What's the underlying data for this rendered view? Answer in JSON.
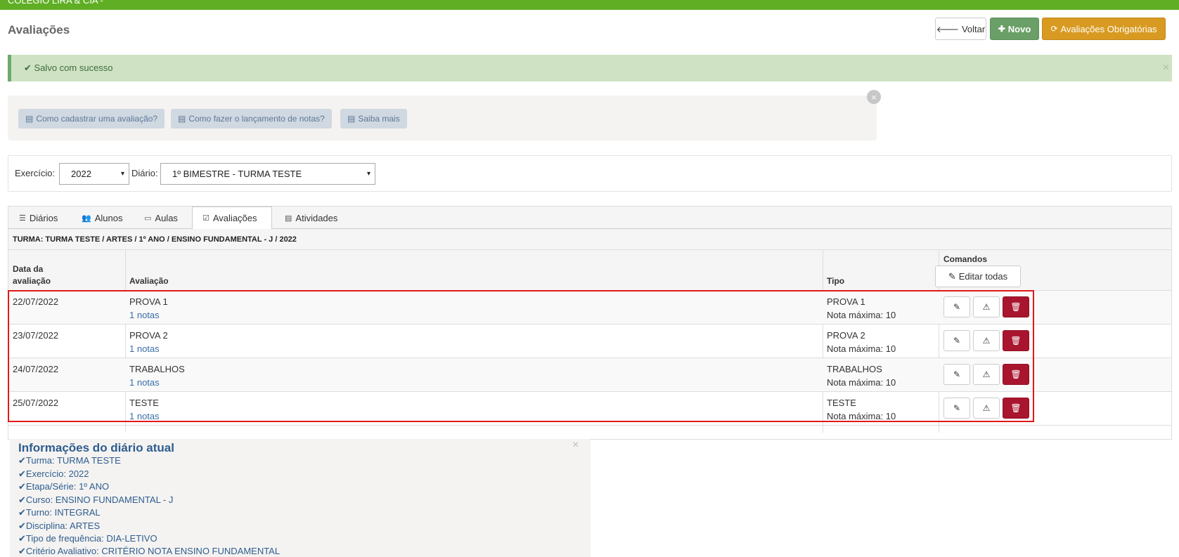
{
  "header": {
    "org_name": "COLÉGIO LIRA & CIA -"
  },
  "page": {
    "title": "Avaliações"
  },
  "toolbar": {
    "voltar_label": "Voltar",
    "novo_label": "Novo",
    "obrigatorias_label": "Avaliações Obrigatórias"
  },
  "alert": {
    "message": "Salvo com sucesso",
    "close": "×"
  },
  "help": {
    "links": [
      "Como cadastrar uma avaliação?",
      "Como fazer o lançamento de notas?",
      "Saiba mais"
    ],
    "close": "×"
  },
  "filters": {
    "exercicio_label": "Exercício:",
    "exercicio_value": "2022",
    "diario_label": "Diário:",
    "diario_value": "1º BIMESTRE - TURMA TESTE"
  },
  "tabs": [
    "Diários",
    "Alunos",
    "Aulas",
    "Avaliações",
    "Atividades"
  ],
  "turma_line": "TURMA: TURMA TESTE / ARTES / 1º ANO / ENSINO FUNDAMENTAL - J / 2022",
  "table": {
    "headers": {
      "data_line1": "Data da",
      "data_line2": "avaliação",
      "avaliacao": "Avaliação",
      "tipo": "Tipo",
      "comandos": "Comandos",
      "editar_todas": "Editar todas"
    },
    "rows": [
      {
        "data": "22/07/2022",
        "avaliacao": "PROVA 1",
        "notas": "1 notas",
        "tipo": "PROVA 1",
        "nota_max": "Nota máxima: 10"
      },
      {
        "data": "23/07/2022",
        "avaliacao": "PROVA 2",
        "notas": "1 notas",
        "tipo": "PROVA 2",
        "nota_max": "Nota máxima: 10"
      },
      {
        "data": "24/07/2022",
        "avaliacao": "TRABALHOS",
        "notas": "1 notas",
        "tipo": "TRABALHOS",
        "nota_max": "Nota máxima: 10"
      },
      {
        "data": "25/07/2022",
        "avaliacao": "TESTE",
        "notas": "1 notas",
        "tipo": "TESTE",
        "nota_max": "Nota máxima: 10"
      }
    ]
  },
  "info": {
    "title": "Informações do diário atual",
    "close": "×",
    "lines": [
      "Turma: TURMA TESTE",
      "Exercício: 2022",
      "Etapa/Série: 1º ANO",
      "Curso: ENSINO FUNDAMENTAL - J",
      "Turno: INTEGRAL",
      "Disciplina: ARTES",
      "Tipo de frequência: DIA-LETIVO",
      "Critério Avaliativo: CRITÉRIO NOTA ENSINO FUNDAMENTAL"
    ]
  },
  "colors": {
    "topbar": "#5fae24",
    "success_bg": "#cfe3c4",
    "novo_button": "#6a9f67",
    "obrigatorias_button": "#d89a20",
    "delete_button": "#a9152e",
    "highlight_border": "#e11919",
    "info_text": "#2e5c8f"
  },
  "icons": {
    "voltar": "arrow-left-icon",
    "novo": "plus-icon",
    "obrigatorias": "refresh-icon",
    "alert": "check-icon",
    "help": "book-icon",
    "edit": "edit-icon",
    "warning": "warning-icon",
    "delete": "trash-icon"
  }
}
